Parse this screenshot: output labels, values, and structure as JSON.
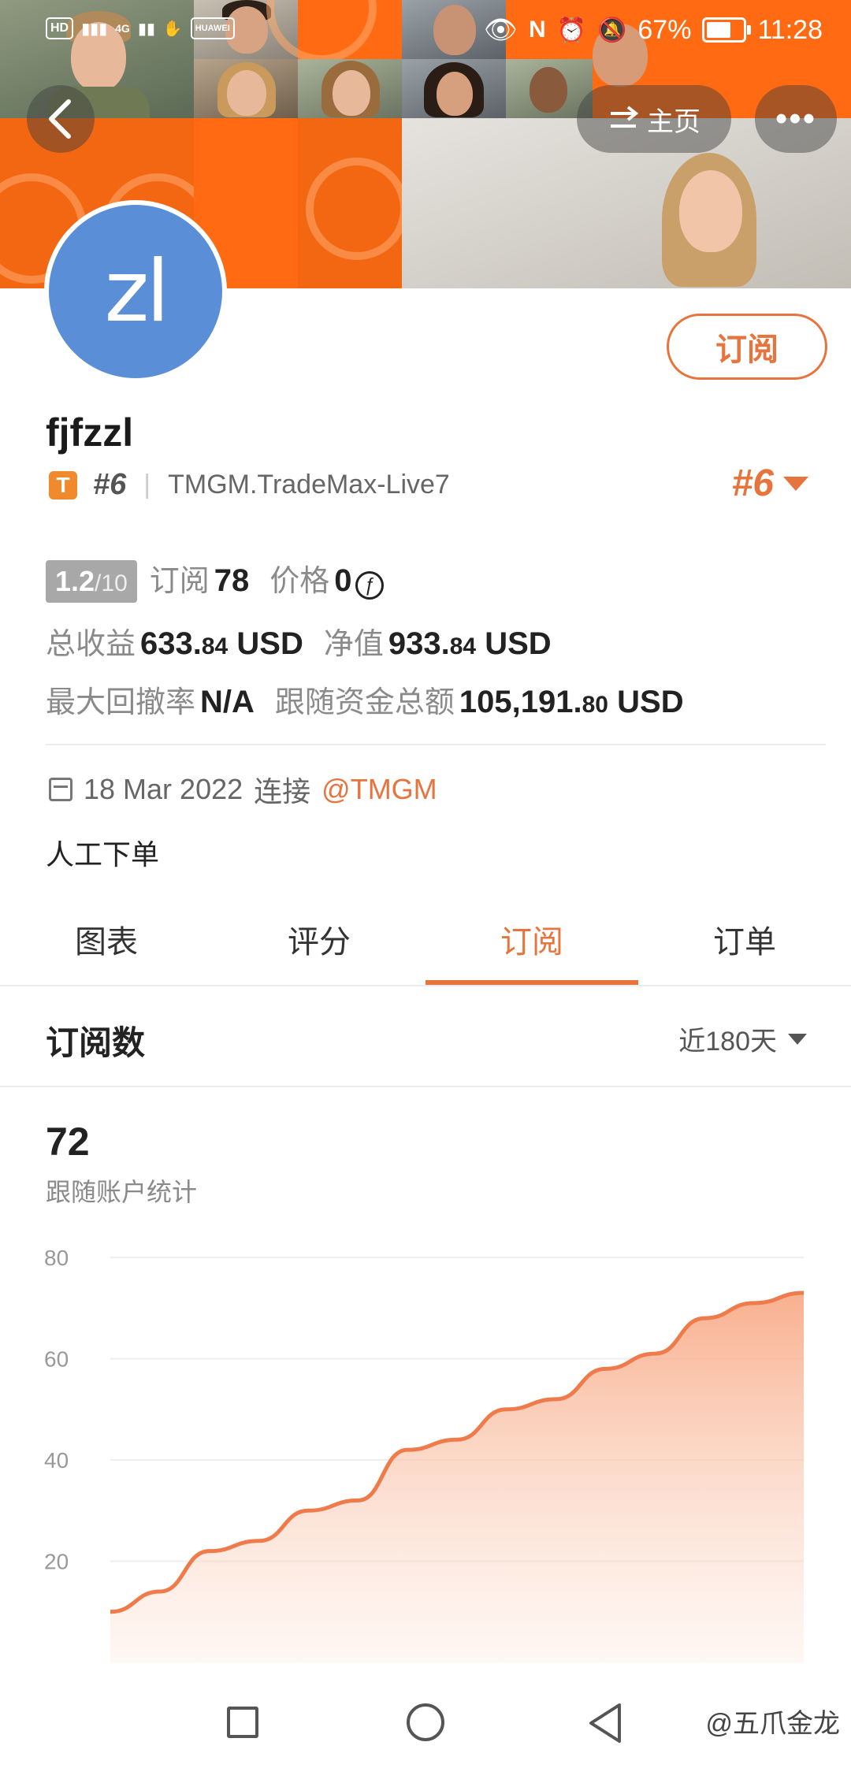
{
  "status_bar": {
    "left_labels": [
      "HD",
      "4G",
      "HUAWEI"
    ],
    "battery": "67%",
    "time": "11:28"
  },
  "header": {
    "home_label": "主页",
    "more_label": "•••"
  },
  "profile": {
    "avatar_initials": "zl",
    "subscribe_button": "订阅",
    "username": "fjfzzl",
    "badge_letter": "T",
    "rank": "#6",
    "server": "TMGM.TradeMax-Live7",
    "rank_right": "#6"
  },
  "stats": {
    "score": "1.2",
    "score_den": "/10",
    "subscribers_label": "订阅",
    "subscribers": "78",
    "price_label": "价格",
    "price": "0",
    "coin_symbol": "ƒ",
    "total_profit_label": "总收益",
    "total_profit_int": "633.",
    "total_profit_dec": "84",
    "total_profit_unit": "USD",
    "equity_label": "净值",
    "equity_int": "933.",
    "equity_dec": "84",
    "equity_unit": "USD",
    "drawdown_label": "最大回撤率",
    "drawdown": "N/A",
    "follow_funds_label": "跟随资金总额",
    "follow_funds_int": "105,191.",
    "follow_funds_dec": "80",
    "follow_funds_unit": "USD"
  },
  "connection": {
    "date": "18 Mar 2022",
    "connect_label": "连接",
    "broker": "@TMGM"
  },
  "description": "人工下单",
  "tabs": [
    "图表",
    "评分",
    "订阅",
    "订单"
  ],
  "active_tab": 2,
  "section": {
    "title": "订阅数",
    "range": "近180天"
  },
  "summary": {
    "value": "72",
    "caption": "跟随账户统计"
  },
  "chart_data": {
    "type": "area",
    "x": [
      0,
      1,
      2,
      3,
      4,
      5,
      6,
      7,
      8,
      9,
      10,
      11,
      12,
      13
    ],
    "values": [
      10,
      14,
      22,
      24,
      30,
      32,
      42,
      44,
      50,
      52,
      58,
      61,
      68,
      71,
      73
    ],
    "yticks": [
      20,
      40,
      60,
      80
    ],
    "ylim": [
      0,
      80
    ],
    "color": "#ef7a4a"
  },
  "watermark": "@五爪金龙",
  "colors": {
    "accent": "#e8743d",
    "banner": "#ff6a13",
    "avatar": "#5a8fd8"
  }
}
